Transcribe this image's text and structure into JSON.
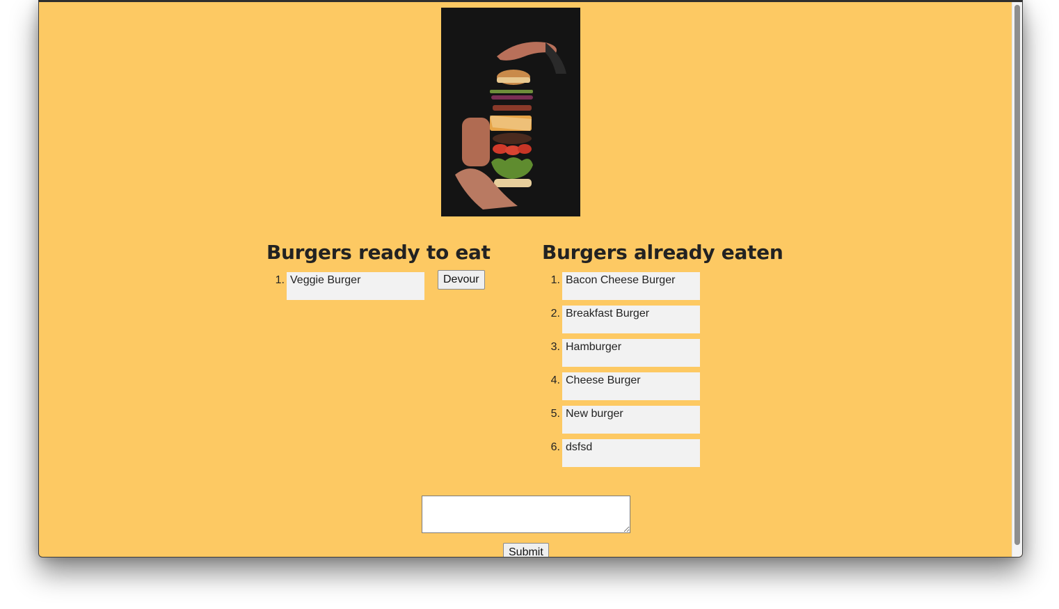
{
  "hero": {
    "image_name": "floating-burger-photo"
  },
  "ready": {
    "heading": "Burgers ready to eat",
    "items": [
      {
        "number": "1.",
        "name": "Veggie Burger",
        "action_label": "Devour"
      }
    ]
  },
  "eaten": {
    "heading": "Burgers already eaten",
    "items": [
      {
        "number": "1.",
        "name": "Bacon Cheese Burger"
      },
      {
        "number": "2.",
        "name": "Breakfast Burger"
      },
      {
        "number": "3.",
        "name": "Hamburger"
      },
      {
        "number": "4.",
        "name": "Cheese Burger"
      },
      {
        "number": "5.",
        "name": "New burger"
      },
      {
        "number": "6.",
        "name": "dsfsd"
      }
    ]
  },
  "form": {
    "input_value": "",
    "submit_label": "Submit"
  },
  "colors": {
    "page_background": "#fdc963",
    "item_background": "#f2f2f2"
  }
}
